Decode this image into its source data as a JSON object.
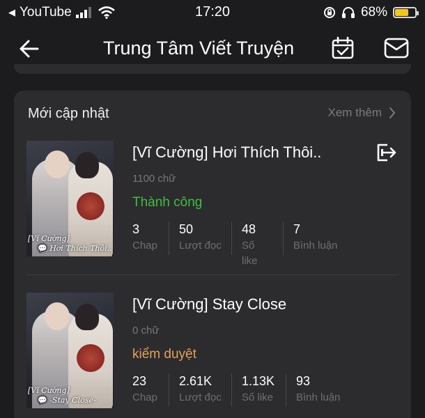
{
  "status_bar": {
    "back_app": "YouTube",
    "time": "17:20",
    "battery": "68%",
    "battery_level": 0.68,
    "battery_color": "#f4c81a"
  },
  "nav": {
    "title": "Trung Tâm Viết Truyện",
    "icons": [
      "back-arrow-icon",
      "calendar-check-icon",
      "mail-icon"
    ]
  },
  "section": {
    "title": "Mới cập nhật",
    "see_more": "Xem thêm"
  },
  "stories": [
    {
      "title": "[Vĩ Cường] Hơi Thích Thôi..",
      "word_count": "1100 chữ",
      "status": "Thành công",
      "status_color": "#3fbf3f",
      "cover_caption_1": "[Vĩ Cường]",
      "cover_caption_2": "Hơi Thích Thôi..",
      "stats": [
        {
          "value": "3",
          "label": "Chap"
        },
        {
          "value": "50",
          "label": "Lượt đọc"
        },
        {
          "value": "48",
          "label": "Số like"
        },
        {
          "value": "7",
          "label": "Bình luận"
        }
      ]
    },
    {
      "title": "[Vĩ Cường] Stay Close",
      "word_count": "0 chữ",
      "status": "kiểm duyệt",
      "status_color": "#e3a25a",
      "cover_caption_1": "[Vĩ Cường]",
      "cover_caption_2": "-Stay Close-",
      "stats": [
        {
          "value": "23",
          "label": "Chap"
        },
        {
          "value": "2.61K",
          "label": "Lượt đọc"
        },
        {
          "value": "1.13K",
          "label": "Số like"
        },
        {
          "value": "93",
          "label": "Bình luận"
        }
      ]
    }
  ]
}
